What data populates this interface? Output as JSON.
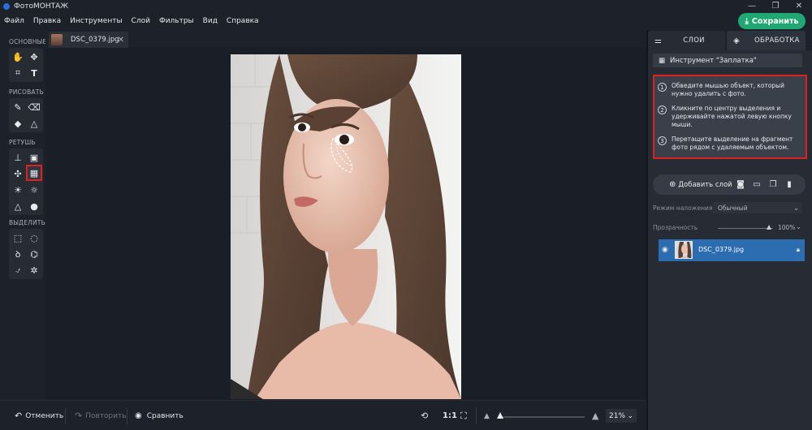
{
  "app": {
    "title": "ФотоМОНТАЖ"
  },
  "window_controls": {
    "minimize": "—",
    "restore": "❐",
    "close": "✕"
  },
  "menu": [
    "Файл",
    "Правка",
    "Инструменты",
    "Слой",
    "Фильтры",
    "Вид",
    "Справка"
  ],
  "save_label": "Сохранить",
  "toolbar": {
    "groups": [
      "ОСНОВНЫЕ",
      "РИСОВАТЬ",
      "РЕТУШЬ",
      "ВЫДЕЛИТЬ"
    ],
    "active_tool": "patch-tool"
  },
  "document_tab": {
    "name": "DSC_0379.jpg",
    "close": "✕"
  },
  "bottombar": {
    "undo": "Отменить",
    "redo": "Повторить",
    "compare": "Сравнить",
    "ratio": "1:1",
    "zoom": "21%",
    "zoom_fraction": 0.03
  },
  "panel": {
    "tabs": [
      "СЛОИ",
      "ОБРАБОТКА"
    ],
    "tool_title": "Инструмент \"Заплатка\"",
    "steps": [
      {
        "num": "1",
        "text": "Обведите мышью объект, который нужно удалить с фото."
      },
      {
        "num": "2",
        "text": "Кликните по центру выделения и удерживайте нажатой левую кнопку мыши."
      },
      {
        "num": "3",
        "text": "Перетащите выделение на фрагмент фото рядом с удаляемым объектом."
      }
    ],
    "add_layer": "Добавить слой",
    "blend_label": "Режим наложения:",
    "blend_value": "Обычный",
    "opacity_label": "Прозрачность",
    "opacity_value": "100%",
    "layer_name": "DSC_0379.jpg"
  },
  "colors": {
    "accent_green": "#1fa873",
    "selection_blue": "#2c6cb0",
    "highlight_red": "#e02020"
  }
}
